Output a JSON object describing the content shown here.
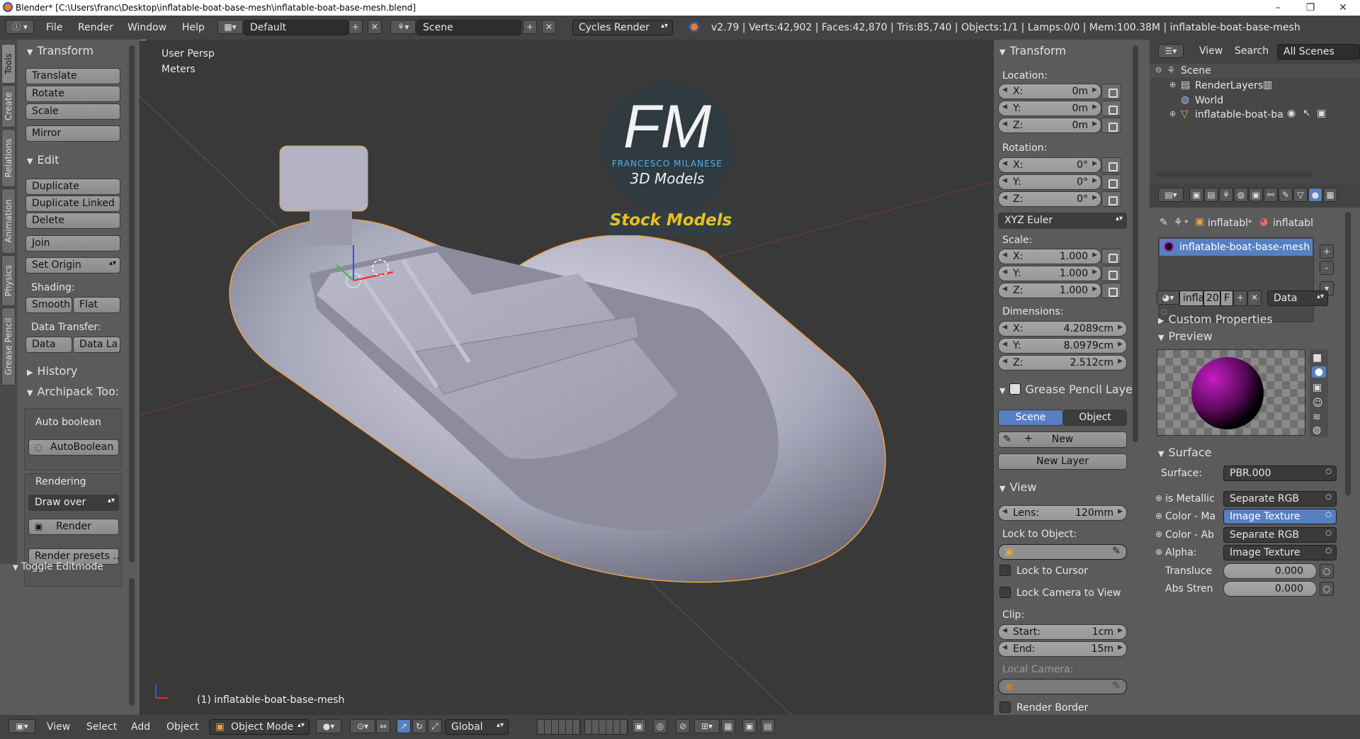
{
  "window": {
    "title": "Blender* [C:\\Users\\franc\\Desktop\\inflatable-boat-base-mesh\\inflatable-boat-base-mesh.blend]",
    "minimize": "–",
    "maximize": "❐",
    "close": "✕"
  },
  "topmenu": {
    "menus": [
      "File",
      "Render",
      "Window",
      "Help"
    ],
    "layout": "Default",
    "scene": "Scene",
    "engine": "Cycles Render",
    "stats": "v2.79 | Verts:42,902 | Faces:42,870 | Tris:85,740 | Objects:1/1 | Lamps:0/0 | Mem:100.38M | inflatable-boat-base-mesh"
  },
  "tabs": [
    "Tools",
    "Create",
    "Relations",
    "Animation",
    "Physics",
    "Grease Pencil"
  ],
  "toolshelf": {
    "transform_header": "Transform",
    "translate": "Translate",
    "rotate": "Rotate",
    "scale": "Scale",
    "mirror": "Mirror",
    "edit_header": "Edit",
    "duplicate": "Duplicate",
    "duplicate_linked": "Duplicate Linked",
    "delete": "Delete",
    "join": "Join",
    "set_origin": "Set Origin",
    "shading_label": "Shading:",
    "smooth": "Smooth",
    "flat": "Flat",
    "data_transfer_label": "Data Transfer:",
    "data": "Data",
    "data_la": "Data La",
    "history_header": "History",
    "archipack_header": "Archipack Too:",
    "auto_boolean_label": "Auto boolean",
    "autoboolean": "AutoBoolean",
    "rendering_label": "Rendering",
    "draw_over": "Draw over",
    "render": "Render",
    "render_presets": "Render presets ...",
    "toggle_editmode": "Toggle Editmode"
  },
  "viewport": {
    "view_name": "User Persp",
    "units": "Meters",
    "object_label": "(1) inflatable-boat-base-mesh",
    "logo_letters": "FM",
    "logo_name": "FRANCESCO MILANESE",
    "logo_sub": "3D Models",
    "logo_banner": "Stock Models"
  },
  "npanel": {
    "transform_header": "Transform",
    "location_label": "Location:",
    "location": [
      {
        "axis": "X:",
        "value": "0m"
      },
      {
        "axis": "Y:",
        "value": "0m"
      },
      {
        "axis": "Z:",
        "value": "0m"
      }
    ],
    "rotation_label": "Rotation:",
    "rotation": [
      {
        "axis": "X:",
        "value": "0°"
      },
      {
        "axis": "Y:",
        "value": "0°"
      },
      {
        "axis": "Z:",
        "value": "0°"
      }
    ],
    "rotation_mode": "XYZ Euler",
    "scale_label": "Scale:",
    "scale": [
      {
        "axis": "X:",
        "value": "1.000"
      },
      {
        "axis": "Y:",
        "value": "1.000"
      },
      {
        "axis": "Z:",
        "value": "1.000"
      }
    ],
    "dimensions_label": "Dimensions:",
    "dimensions": [
      {
        "axis": "X:",
        "value": "4.2089cm"
      },
      {
        "axis": "Y:",
        "value": "8.0979cm"
      },
      {
        "axis": "Z:",
        "value": "2.512cm"
      }
    ],
    "gp_header": "Grease Pencil Layer",
    "gp_scene": "Scene",
    "gp_object": "Object",
    "gp_new": "New",
    "gp_new_layer": "New Layer",
    "view_header": "View",
    "lens_label": "Lens:",
    "lens_value": "120mm",
    "lock_object_label": "Lock to Object:",
    "lock_cursor": "Lock to Cursor",
    "lock_camera": "Lock Camera to View",
    "clip_label": "Clip:",
    "clip_start_label": "Start:",
    "clip_start": "1cm",
    "clip_end_label": "End:",
    "clip_end": "15m",
    "local_camera": "Local Camera:",
    "render_border": "Render Border"
  },
  "outliner": {
    "view": "View",
    "search": "Search",
    "all_scenes": "All Scenes",
    "items": [
      "Scene",
      "RenderLayers",
      "World",
      "inflatable-boat-base-m"
    ]
  },
  "props": {
    "breadcrumb_1": "inflatabl",
    "breadcrumb_2": "inflatabl",
    "material_slot": "inflatable-boat-base-mesh",
    "mat_name": "infla",
    "mat_users": "20",
    "mat_f": "F",
    "link": "Data",
    "custom_props": "Custom Properties",
    "preview": "Preview",
    "surface_header": "Surface",
    "surface_label": "Surface:",
    "surface_value": "PBR.000",
    "inputs": [
      {
        "label": "is Metallic",
        "value": "Separate RGB"
      },
      {
        "label": "Color - Ma",
        "value": "Image Texture"
      },
      {
        "label": "Color - Ab",
        "value": "Separate RGB"
      },
      {
        "label": "Alpha:",
        "value": "Image Texture"
      }
    ],
    "translucent_label": "Transluce",
    "translucent_value": "0.000",
    "abs_label": "Abs Stren",
    "abs_value": "0.000"
  },
  "bottombar": {
    "menus": [
      "View",
      "Select",
      "Add",
      "Object"
    ],
    "mode": "Object Mode",
    "orientation": "Global"
  },
  "colors": {
    "accent": "#5680c2",
    "header_bg": "#434343",
    "panel_bg": "#5b5b5b",
    "viewport_bg": "#393939",
    "selection_outline": "#f0a040"
  }
}
